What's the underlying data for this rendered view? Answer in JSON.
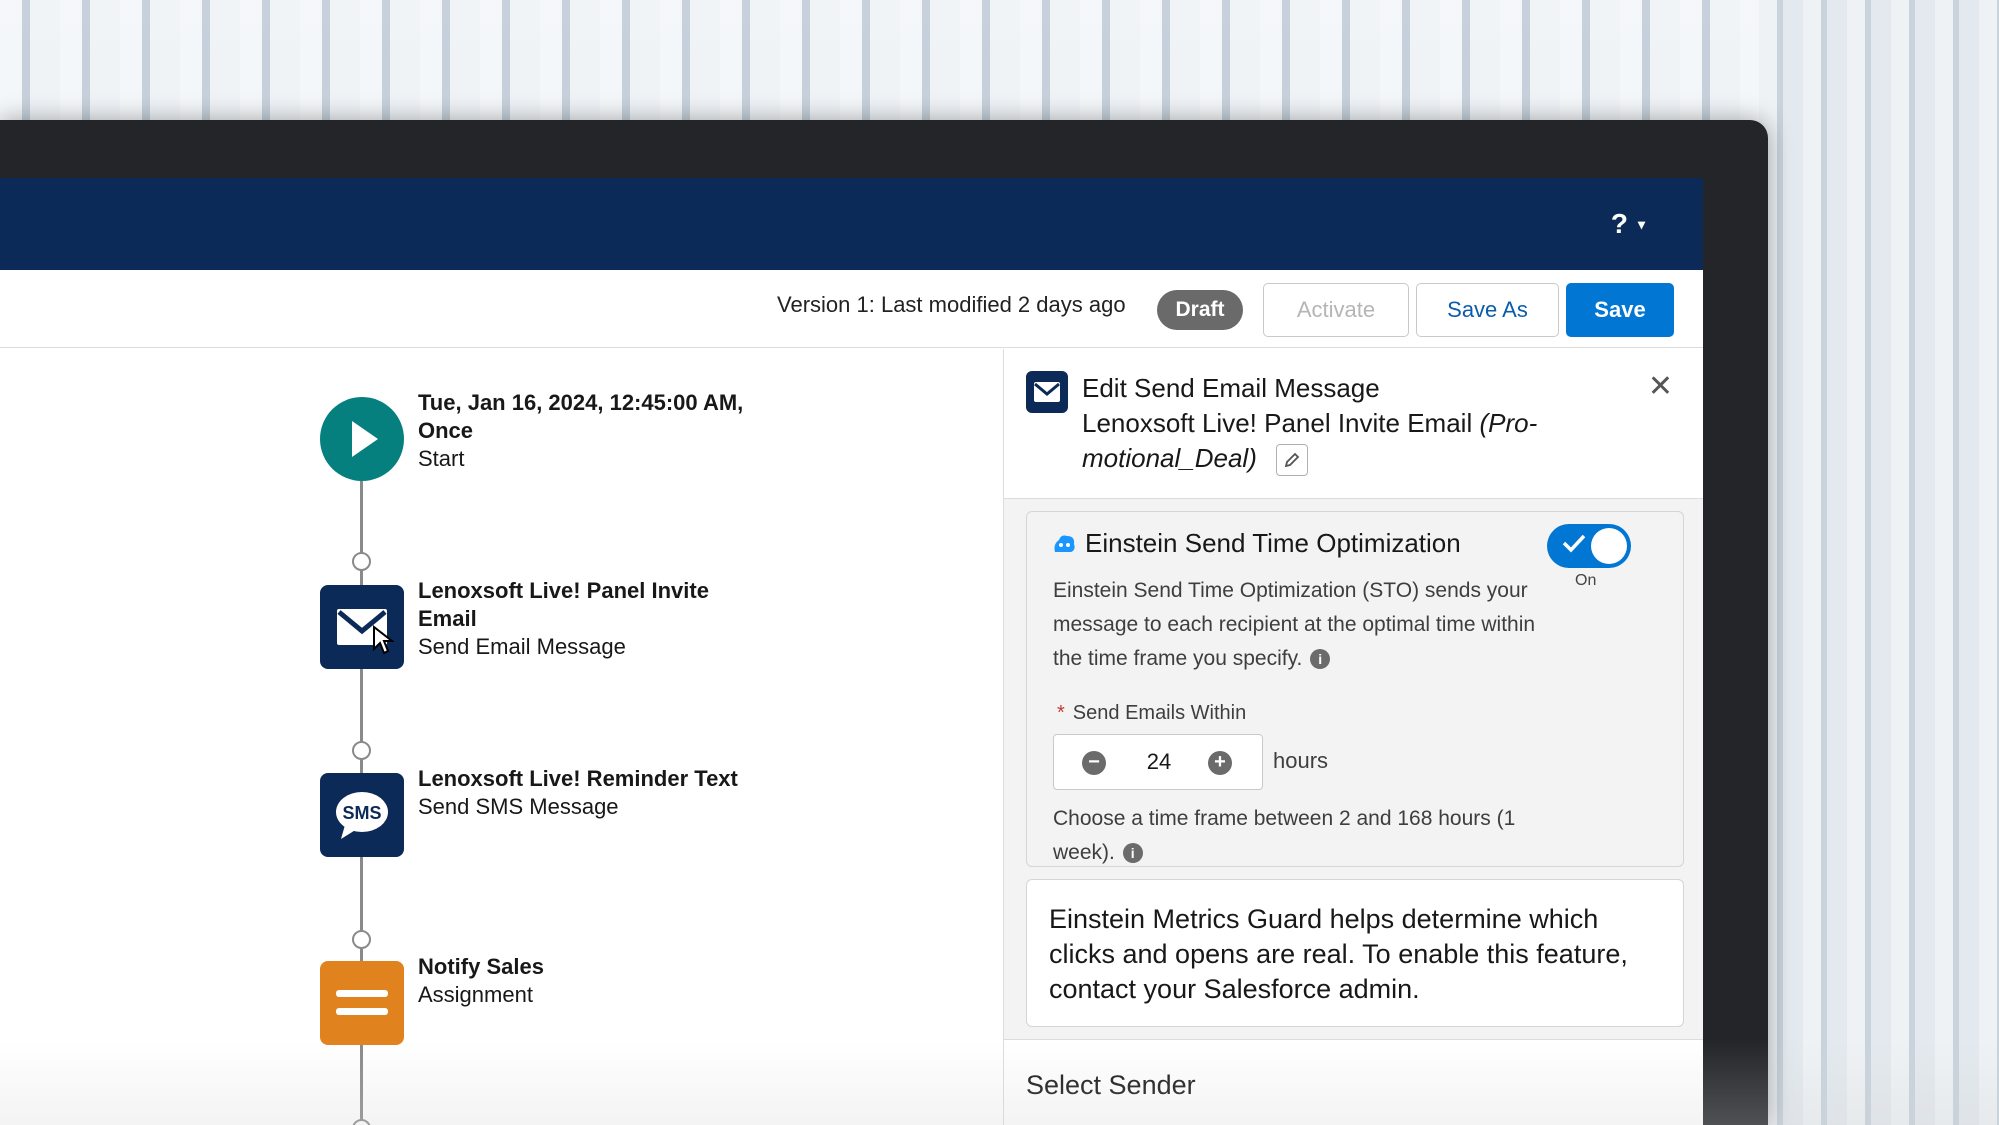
{
  "topbar": {
    "help_label": "?",
    "caret": "▾"
  },
  "toolbar": {
    "version_text": "Version 1: Last modified 2 days ago",
    "status_badge": "Draft",
    "activate_label": "Activate",
    "save_as_label": "Save As",
    "save_label": "Save"
  },
  "flow": {
    "nodes": [
      {
        "title_line1": "Tue, Jan 16, 2024, 12:45:00 AM,",
        "title_line2": "Once",
        "subtitle": "Start",
        "icon": "play-icon"
      },
      {
        "title_line1": "Lenoxsoft Live! Panel Invite",
        "title_line2": "Email",
        "subtitle": "Send Email Message",
        "icon": "envelope-icon"
      },
      {
        "title_line1": "Lenoxsoft Live! Reminder Text",
        "title_line2": "",
        "subtitle": "Send SMS Message",
        "icon": "sms-icon",
        "icon_text": "SMS"
      },
      {
        "title_line1": "Notify Sales",
        "title_line2": "",
        "subtitle": "Assignment",
        "icon": "assignment-icon"
      }
    ]
  },
  "panel": {
    "title_line1": "Edit Send Email Message",
    "title_line2": "Lenoxsoft Live! Panel Invite Email",
    "title_line2_italic": "(Pro-",
    "title_line3_italic": "motional_Deal)",
    "close_label": "✕",
    "sto": {
      "title": "Einstein Send Time Optimization",
      "toggle_label": "On",
      "description": "Einstein Send Time Optimization (STO) sends your message to each recipient at the optimal time within the time frame you specify.",
      "field_label": "Send Emails Within",
      "required_mark": "*",
      "value": "24",
      "minus": "−",
      "plus": "+",
      "unit": "hours",
      "hint": "Choose a time frame between 2 and 168 hours (1 week).",
      "info": "i"
    },
    "metrics_guard": "Einstein Metrics Guard helps determine which clicks and opens are real. To enable this feature, contact your Salesforce admin.",
    "sender_title": "Select Sender"
  },
  "colors": {
    "header": "#0b2a57",
    "brand_blue": "#0176d3",
    "start_teal": "#05807f",
    "assignment_orange": "#e0831f",
    "draft_badge": "#6a6a6a"
  }
}
